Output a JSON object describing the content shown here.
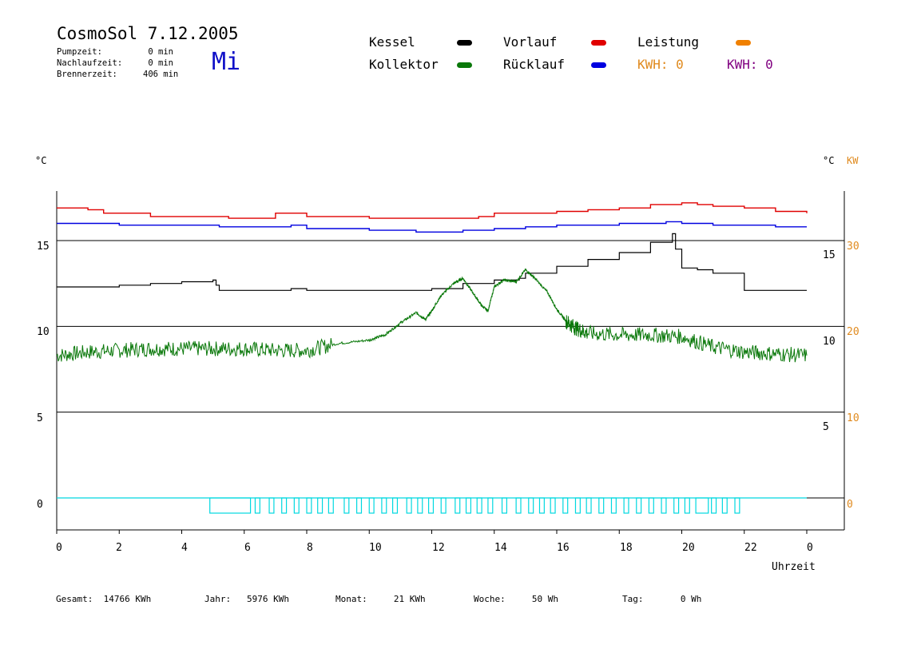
{
  "header": {
    "title": "CosmoSol 7.12.2005",
    "day": "Mi",
    "stats": [
      {
        "label": "Pumpzeit:",
        "value": "0 min"
      },
      {
        "label": "Nachlaufzeit:",
        "value": "0 min"
      },
      {
        "label": "Brennerzeit:",
        "value": "406 min"
      }
    ]
  },
  "legend": {
    "kessel": "Kessel",
    "kollektor": "Kollektor",
    "vorlauf": "Vorlauf",
    "ruecklauf": "Rücklauf",
    "leistung": "Leistung",
    "kwh1": "KWH: 0",
    "kwh2": "KWH: 0"
  },
  "colors": {
    "kessel": "#000000",
    "kollektor": "#0a780a",
    "vorlauf": "#e00000",
    "ruecklauf": "#0000e0",
    "leistung": "#f08000",
    "kwh2": "#800080",
    "pump": "#00d8e0"
  },
  "axes": {
    "left_unit": "°C",
    "right_unit_c": "°C",
    "right_unit_kw": "KW",
    "left_ticks": [
      "15",
      "10",
      "5",
      "0"
    ],
    "right_c_ticks": [
      "15",
      "10",
      "5"
    ],
    "right_kw_ticks": [
      "30",
      "20",
      "10",
      "0"
    ],
    "x_ticks": [
      "0",
      "2",
      "4",
      "6",
      "8",
      "10",
      "12",
      "14",
      "16",
      "18",
      "20",
      "22",
      "0"
    ],
    "xlabel": "Uhrzeit"
  },
  "footer": {
    "gesamt": {
      "label": "Gesamt:",
      "value": "14766 KWh"
    },
    "jahr": {
      "label": "Jahr:",
      "value": "5976 KWh"
    },
    "monat": {
      "label": "Monat:",
      "value": "21 KWh"
    },
    "woche": {
      "label": "Woche:",
      "value": "50 Wh"
    },
    "tag": {
      "label": "Tag:",
      "value": "0 Wh"
    }
  },
  "chart_data": {
    "type": "line",
    "xlabel": "Uhrzeit",
    "ylabel": "°C",
    "xlim": [
      0,
      24
    ],
    "ylim": [
      -1.9,
      17.8
    ],
    "y2label": "KW",
    "y2lim": [
      0,
      30
    ],
    "grid": "horizontal",
    "series": [
      {
        "name": "Vorlauf",
        "x": [
          0,
          1,
          1.5,
          2,
          3,
          4,
          5,
          5.5,
          6,
          6.5,
          7,
          7.5,
          8,
          9,
          10,
          11,
          12,
          13,
          13.5,
          14,
          15,
          16,
          17,
          18,
          19,
          20,
          20.5,
          21,
          22,
          23,
          24
        ],
        "y": [
          16.9,
          16.8,
          16.6,
          16.6,
          16.4,
          16.4,
          16.4,
          16.3,
          16.3,
          16.3,
          16.6,
          16.6,
          16.4,
          16.4,
          16.3,
          16.3,
          16.3,
          16.3,
          16.4,
          16.6,
          16.6,
          16.7,
          16.8,
          16.9,
          17.1,
          17.2,
          17.1,
          17.0,
          16.9,
          16.7,
          16.6
        ]
      },
      {
        "name": "Rücklauf",
        "x": [
          0,
          1,
          2,
          3,
          4,
          5,
          5.2,
          6,
          7,
          7.5,
          8,
          9,
          10,
          11,
          11.5,
          12,
          13,
          14,
          15,
          16,
          17,
          18,
          19,
          19.5,
          20,
          21,
          22,
          23,
          24
        ],
        "y": [
          16.0,
          16.0,
          15.9,
          15.9,
          15.9,
          15.9,
          15.8,
          15.8,
          15.8,
          15.9,
          15.7,
          15.7,
          15.6,
          15.6,
          15.5,
          15.5,
          15.6,
          15.7,
          15.8,
          15.9,
          15.9,
          16.0,
          16.0,
          16.1,
          16.0,
          15.9,
          15.9,
          15.8,
          15.8
        ]
      },
      {
        "name": "Kessel",
        "x": [
          0,
          2,
          3,
          4,
          5,
          5.1,
          5.2,
          6,
          7,
          7.5,
          8,
          10,
          12,
          13,
          14,
          14.8,
          15,
          16,
          17,
          18,
          19,
          19.7,
          19.8,
          20,
          20.5,
          21,
          21.5,
          22,
          23,
          24
        ],
        "y": [
          12.3,
          12.4,
          12.5,
          12.6,
          12.7,
          12.4,
          12.1,
          12.1,
          12.1,
          12.2,
          12.1,
          12.1,
          12.2,
          12.5,
          12.7,
          12.8,
          13.1,
          13.5,
          13.9,
          14.3,
          14.9,
          15.4,
          14.5,
          13.4,
          13.3,
          13.1,
          13.1,
          12.1,
          12.1,
          12.1
        ]
      },
      {
        "name": "Kollektor",
        "x": [
          0,
          1,
          2,
          3,
          4,
          5,
          6,
          7,
          8,
          9,
          10,
          10.5,
          11,
          11.5,
          11.8,
          12,
          12.3,
          12.7,
          13,
          13.3,
          13.6,
          13.8,
          14,
          14.3,
          14.7,
          15,
          15.3,
          15.7,
          16,
          16.3,
          16.6,
          17,
          18,
          19,
          20,
          21,
          22,
          23,
          24
        ],
        "y": [
          8.3,
          8.5,
          8.6,
          8.7,
          8.7,
          8.7,
          8.7,
          8.6,
          8.6,
          9.0,
          9.2,
          9.5,
          10.2,
          10.8,
          10.4,
          10.9,
          11.8,
          12.5,
          12.8,
          12.0,
          11.2,
          10.9,
          12.3,
          12.7,
          12.6,
          13.3,
          12.8,
          12.0,
          11.0,
          10.3,
          9.9,
          9.6,
          9.5,
          9.5,
          9.4,
          8.8,
          8.5,
          8.4,
          8.3
        ]
      }
    ],
    "pump_intervals": [
      [
        4.9,
        6.2
      ],
      [
        6.35,
        6.5
      ],
      [
        6.8,
        6.95
      ],
      [
        7.2,
        7.35
      ],
      [
        7.6,
        7.75
      ],
      [
        8.0,
        8.15
      ],
      [
        8.35,
        8.5
      ],
      [
        8.7,
        8.85
      ],
      [
        9.2,
        9.35
      ],
      [
        9.6,
        9.75
      ],
      [
        10.0,
        10.15
      ],
      [
        10.4,
        10.55
      ],
      [
        10.75,
        10.9
      ],
      [
        11.2,
        11.35
      ],
      [
        11.55,
        11.7
      ],
      [
        11.9,
        12.05
      ],
      [
        12.3,
        12.45
      ],
      [
        12.75,
        12.9
      ],
      [
        13.1,
        13.25
      ],
      [
        13.45,
        13.6
      ],
      [
        13.8,
        13.95
      ],
      [
        14.25,
        14.4
      ],
      [
        14.7,
        14.85
      ],
      [
        15.1,
        15.25
      ],
      [
        15.45,
        15.6
      ],
      [
        15.8,
        15.95
      ],
      [
        16.2,
        16.35
      ],
      [
        16.6,
        16.75
      ],
      [
        16.95,
        17.1
      ],
      [
        17.35,
        17.5
      ],
      [
        17.75,
        17.9
      ],
      [
        18.15,
        18.3
      ],
      [
        18.55,
        18.7
      ],
      [
        18.95,
        19.1
      ],
      [
        19.35,
        19.5
      ],
      [
        19.75,
        19.9
      ],
      [
        20.1,
        20.25
      ],
      [
        20.45,
        20.85
      ],
      [
        20.95,
        21.1
      ],
      [
        21.3,
        21.45
      ],
      [
        21.7,
        21.85
      ]
    ]
  }
}
